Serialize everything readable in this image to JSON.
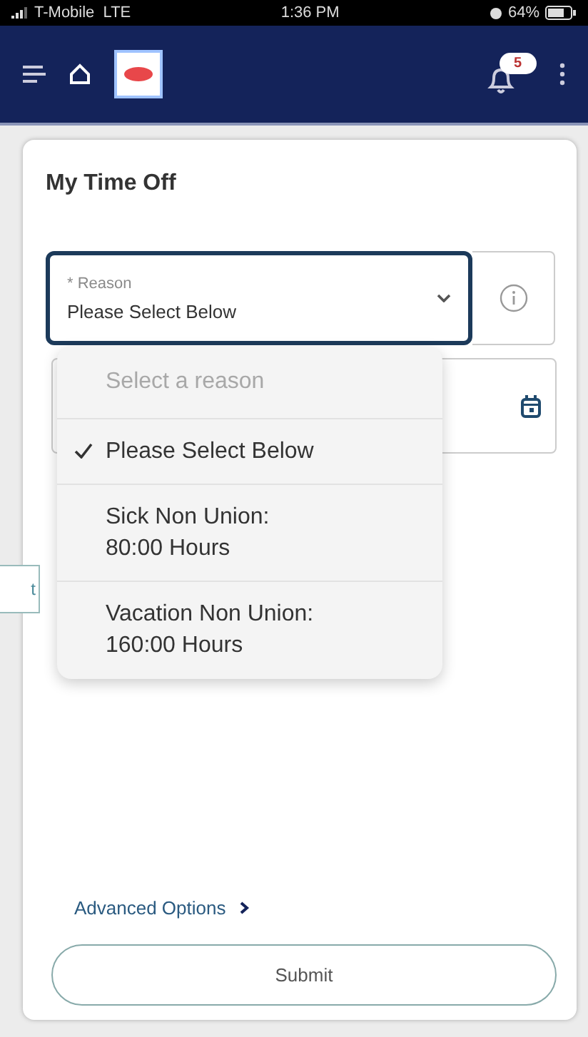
{
  "status_bar": {
    "carrier": "T-Mobile  LTE",
    "time": "1:36 PM",
    "battery": "64%"
  },
  "header": {
    "notification_count": "5"
  },
  "card": {
    "title": "My Time Off",
    "reason_field": {
      "label": "* Reason",
      "value": "Please Select Below",
      "focused": true
    },
    "dropdown": {
      "options": [
        {
          "label": "Select a reason",
          "selected": false,
          "disabled": true
        },
        {
          "label": "Please Select Below",
          "selected": true,
          "disabled": false
        },
        {
          "label": "Sick Non Union:\n80:00 Hours",
          "selected": false,
          "disabled": false
        },
        {
          "label": "Vacation Non Union:\n160:00 Hours",
          "selected": false,
          "disabled": false
        }
      ]
    },
    "advanced_options": "Advanced Options",
    "submit": "Submit"
  },
  "background_fragment": "t"
}
